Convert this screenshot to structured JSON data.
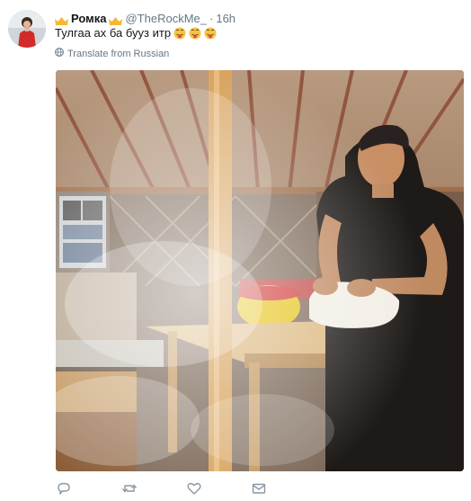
{
  "tweet": {
    "display_name": "Ромка",
    "handle": "@TheRockMe_",
    "separator": "·",
    "time": "16h",
    "text": "Тулгаа ах ба бууз итр",
    "translate_label": "Translate from Russian"
  },
  "icons": {
    "crown": "crown-emoji",
    "tongue": "tongue-out-face-emoji",
    "globe": "globe-icon",
    "reply": "reply-icon",
    "retweet": "retweet-icon",
    "like": "heart-icon",
    "message": "envelope-icon"
  },
  "colors": {
    "text": "#14171a",
    "secondary": "#657786",
    "icon": "#8a97a3",
    "crown": "#f7b731"
  }
}
